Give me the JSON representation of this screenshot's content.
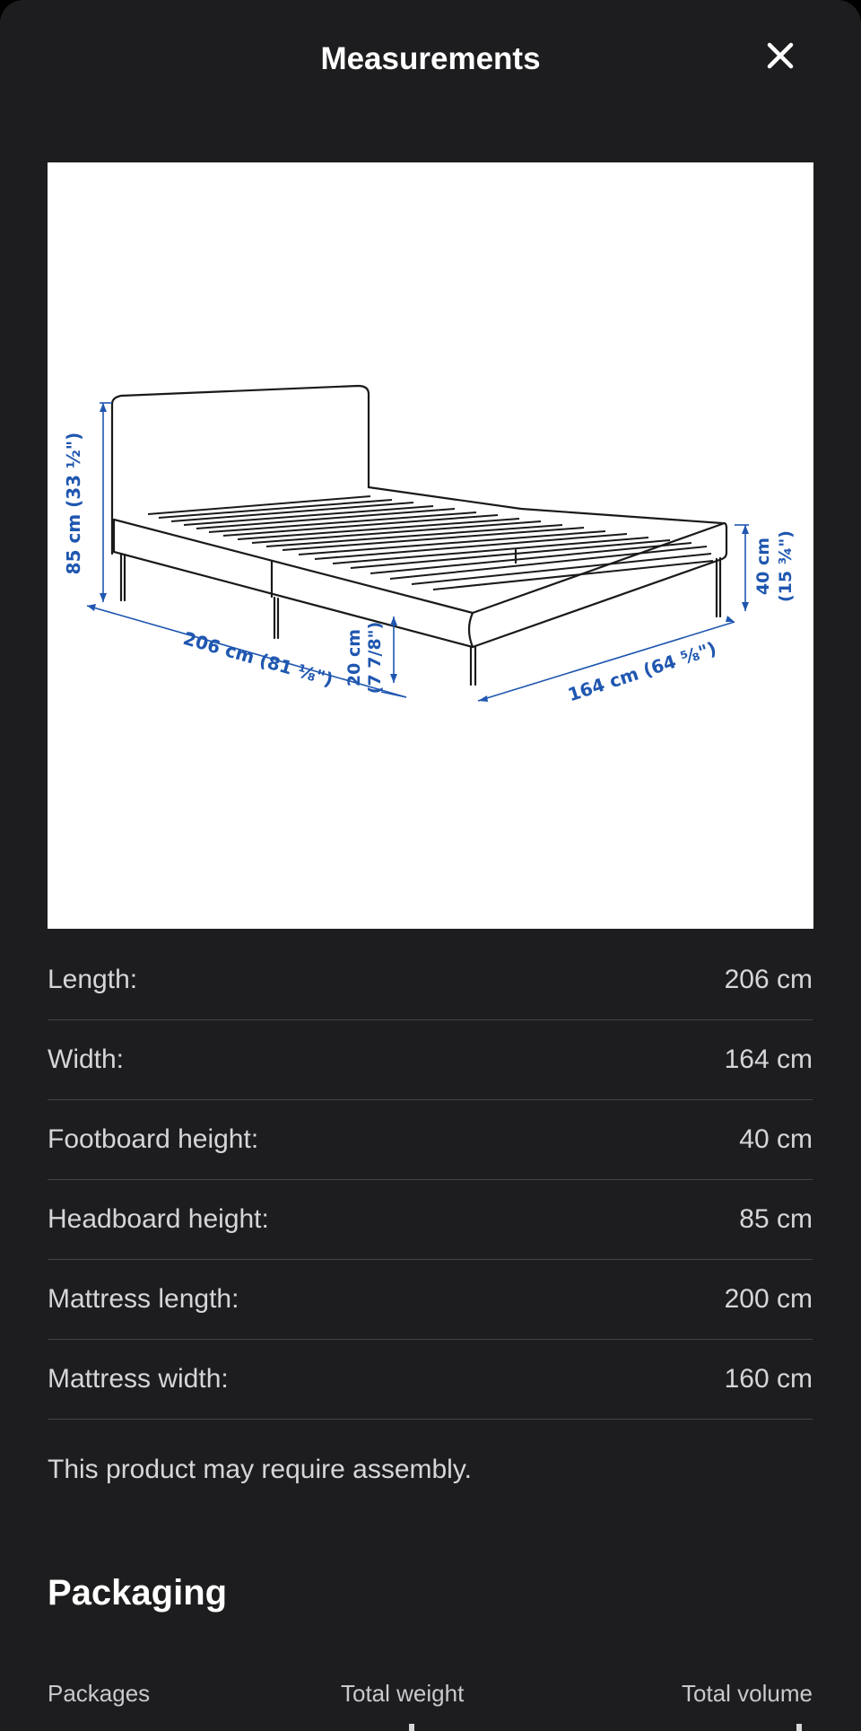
{
  "header": {
    "title": "Measurements",
    "close_icon": "close-icon"
  },
  "diagram": {
    "labels": {
      "headboard": "85 cm (33 ½\")",
      "length": "206 cm (81 ⅛\")",
      "clearance_cm": "20 cm",
      "clearance_in": "(7 7/8\")",
      "width": "164 cm (64 ⅝\")",
      "footboard_cm": "40 cm",
      "footboard_in": "(15 ¾\")"
    },
    "label_color": "#1f57b0"
  },
  "dimensions": [
    {
      "label": "Length:",
      "value": "206 cm"
    },
    {
      "label": "Width:",
      "value": "164 cm"
    },
    {
      "label": "Footboard height:",
      "value": "40 cm"
    },
    {
      "label": "Headboard height:",
      "value": "85 cm"
    },
    {
      "label": "Mattress length:",
      "value": "200 cm"
    },
    {
      "label": "Mattress width:",
      "value": "160 cm"
    }
  ],
  "assembly_note": "This product may require assembly.",
  "packaging": {
    "title": "Packaging",
    "columns": [
      "Packages",
      "Total weight",
      "Total volume"
    ]
  },
  "colors": {
    "background": "#1d1d1f",
    "text": "#d6d6d8",
    "divider": "#444448"
  }
}
